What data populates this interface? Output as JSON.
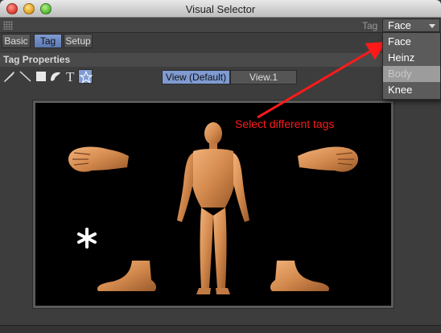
{
  "window": {
    "title": "Visual Selector"
  },
  "tagbar": {
    "label": "Tag",
    "selected": "Face"
  },
  "tabs": [
    {
      "label": "Basic",
      "active": false
    },
    {
      "label": "Tag",
      "active": true
    },
    {
      "label": "Setup",
      "active": false
    }
  ],
  "section": {
    "title": "Tag Properties"
  },
  "tools": [
    {
      "icon": "pencil-icon"
    },
    {
      "icon": "line-icon"
    },
    {
      "icon": "square-icon"
    },
    {
      "icon": "lasso-icon"
    },
    {
      "icon": "text-icon"
    },
    {
      "icon": "star-icon",
      "active": true
    }
  ],
  "views": [
    {
      "label": "View (Default)",
      "active": true
    },
    {
      "label": "View.1",
      "active": false
    }
  ],
  "annotation": {
    "text": "Select different tags"
  },
  "dropdown": {
    "items": [
      {
        "label": "Face",
        "selected": false
      },
      {
        "label": "Heinz",
        "selected": false
      },
      {
        "label": "Body",
        "selected": true
      },
      {
        "label": "Knee",
        "selected": false
      }
    ]
  },
  "colors": {
    "accent": "#7f9bd2",
    "annotation": "#ff1a1a",
    "skin": "#d9935a"
  }
}
